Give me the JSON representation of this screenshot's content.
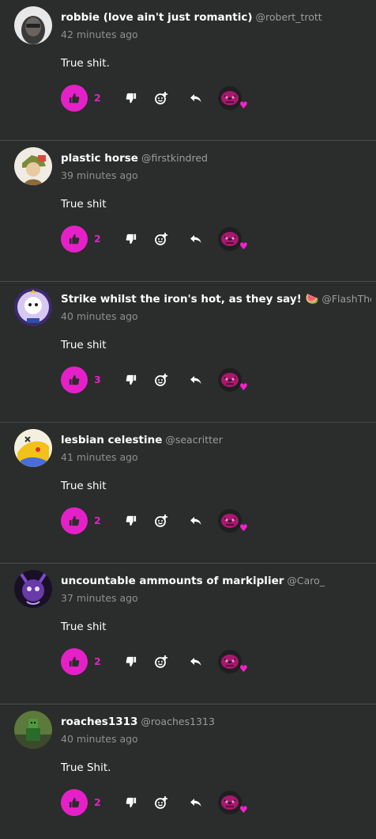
{
  "colors": {
    "background": "#2a2d2b",
    "accent": "#e620c8",
    "divider": "#4a4d4b",
    "muted_text": "#8d908e"
  },
  "comments": [
    {
      "name": "robbie (love ain't just romantic)",
      "handle": "@robert_trott",
      "time": "42 minutes ago",
      "text": "True shit.",
      "likes": "2"
    },
    {
      "name": "plastic horse",
      "handle": "@firstkindred",
      "time": "39 minutes ago",
      "text": "True shit",
      "likes": "2"
    },
    {
      "name": "Strike whilst the iron's hot, as they say! 🍉",
      "handle": "@FlashTheCat",
      "time": "40 minutes ago",
      "text": "True shit",
      "likes": "3"
    },
    {
      "name": "lesbian celestine",
      "handle": "@seacritter",
      "time": "41 minutes ago",
      "text": "True shit",
      "likes": "2"
    },
    {
      "name": "uncountable ammounts of markiplier",
      "handle": "@Caro_",
      "time": "37 minutes ago",
      "text": "True shit",
      "likes": "2"
    },
    {
      "name": "roaches1313",
      "handle": "@roaches1313",
      "time": "40 minutes ago",
      "text": "True Shit.",
      "likes": "2"
    }
  ],
  "icons": {
    "like": "thumbs-up-icon",
    "dislike": "thumbs-down-icon",
    "react": "add-reaction-icon",
    "reply": "reply-icon",
    "reaction_badge": "heart-icon"
  },
  "heart_glyph": "♥"
}
